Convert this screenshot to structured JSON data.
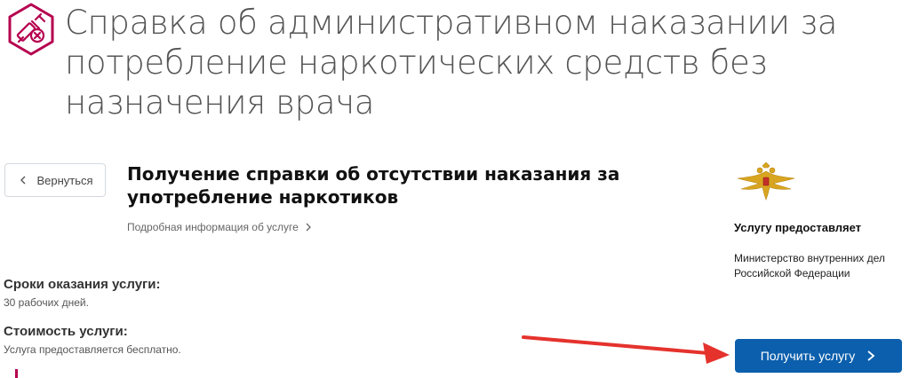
{
  "page": {
    "title": "Справка об административном наказании за потребление наркотических средств без назначения врача"
  },
  "service": {
    "back_label": "Вернуться",
    "title": "Получение справки об отсутствии наказания за употребление наркотиков",
    "details_link": "Подробная информация об услуге"
  },
  "info": {
    "terms_label": "Сроки оказания услуги:",
    "terms_value": "30 рабочих дней.",
    "cost_label": "Стоимость услуги:",
    "cost_value": "Услуга предоставляется бесплатно."
  },
  "provider": {
    "label": "Услугу предоставляет",
    "name": "Министерство внутренних дел Российской Федерации"
  },
  "actions": {
    "get_service": "Получить услугу"
  },
  "colors": {
    "accent": "#b6004f",
    "primary_button": "#0b5fad",
    "arrow": "#e5322d"
  },
  "icons": {
    "service": "syringe-prohibited-icon",
    "emblem": "double-headed-eagle-emblem"
  }
}
